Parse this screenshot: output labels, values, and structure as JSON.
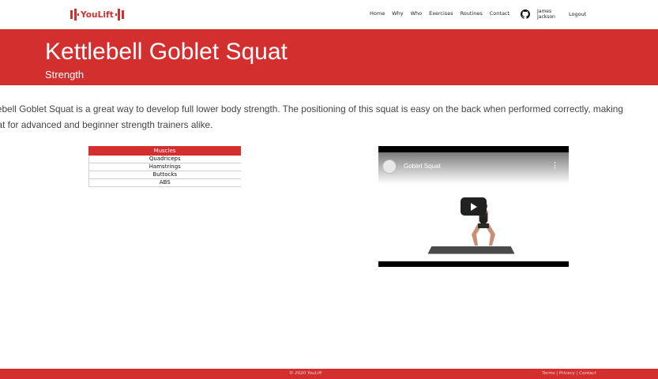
{
  "nav": {
    "logo_text": "YouLift",
    "links": [
      "Home",
      "Why",
      "Who",
      "Exercises",
      "Routines",
      "Contact"
    ],
    "user_first": "James",
    "user_last": "Jackson",
    "logout": "Logout"
  },
  "hero": {
    "title": "Kettlebell Goblet Squat",
    "category": "Strength"
  },
  "description": {
    "line1": "tlebell Goblet Squat is a great way to develop full lower body strength. The positioning of this squat is easy on the back when performed correctly, making",
    "line2": "uat for advanced and beginner strength trainers alike."
  },
  "muscles": {
    "header": "Muscles",
    "rows": [
      "Quadriceps",
      "Hamstrings",
      "Buttocks",
      "ABS"
    ]
  },
  "video": {
    "title": "Goblet Squat",
    "menu_icon": "more-vertical-icon",
    "play_icon": "play-icon"
  },
  "footer": {
    "copyright": "© 2020 YouLift",
    "links": "Terms | Privacy | Contact"
  },
  "colors": {
    "brand_red": "#d32f2f"
  }
}
